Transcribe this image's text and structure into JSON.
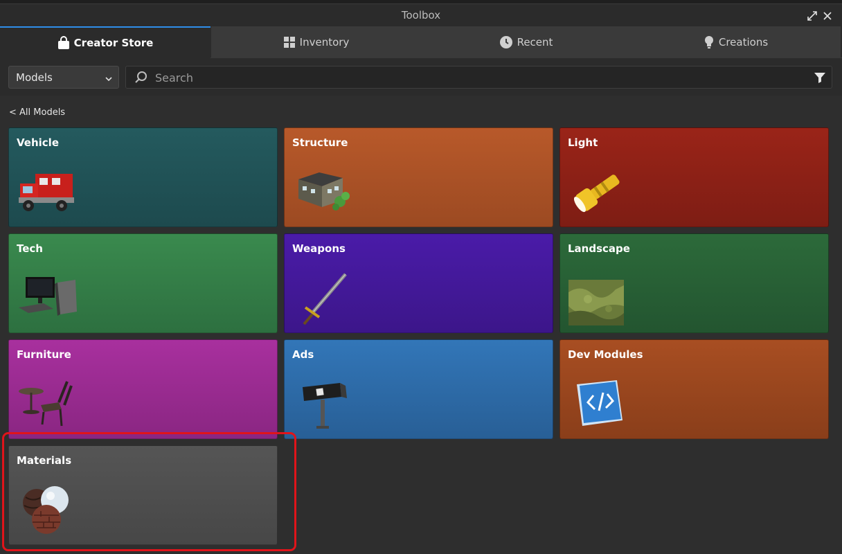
{
  "window": {
    "title": "Toolbox"
  },
  "tabs": [
    {
      "label": "Creator Store",
      "icon": "bag-icon",
      "active": true
    },
    {
      "label": "Inventory",
      "icon": "grid-icon",
      "active": false
    },
    {
      "label": "Recent",
      "icon": "clock-icon",
      "active": false
    },
    {
      "label": "Creations",
      "icon": "lightbulb-icon",
      "active": false
    }
  ],
  "search": {
    "category": "Models",
    "placeholder": "Search"
  },
  "breadcrumb": {
    "back_label": "< All Models"
  },
  "categories": [
    {
      "label": "Vehicle",
      "color_top": "#245a5e",
      "color_bottom": "#1d4a4e",
      "icon": "fire-truck-icon"
    },
    {
      "label": "Structure",
      "color_top": "#b8592a",
      "color_bottom": "#9c4a22",
      "icon": "house-icon"
    },
    {
      "label": "Light",
      "color_top": "#9a2418",
      "color_bottom": "#7e1d14",
      "icon": "flashlight-icon"
    },
    {
      "label": "Tech",
      "color_top": "#3a8a4e",
      "color_bottom": "#2d7040",
      "icon": "computer-icon"
    },
    {
      "label": "Weapons",
      "color_top": "#4a1ba8",
      "color_bottom": "#3c168a",
      "icon": "sword-icon"
    },
    {
      "label": "Landscape",
      "color_top": "#2c6a3a",
      "color_bottom": "#235530",
      "icon": "terrain-icon"
    },
    {
      "label": "Furniture",
      "color_top": "#a8309e",
      "color_bottom": "#8a2682",
      "icon": "chair-table-icon"
    },
    {
      "label": "Ads",
      "color_top": "#3276b8",
      "color_bottom": "#285f96",
      "icon": "billboard-icon"
    },
    {
      "label": "Dev Modules",
      "color_top": "#a84e22",
      "color_bottom": "#8a3e1a",
      "icon": "code-module-icon"
    },
    {
      "label": "Materials",
      "color_top": "#555555",
      "color_bottom": "#474747",
      "icon": "material-spheres-icon"
    }
  ],
  "colors": {
    "accent": "#2f8eea",
    "highlight": "#e0141a",
    "background": "#2e2e2e"
  }
}
